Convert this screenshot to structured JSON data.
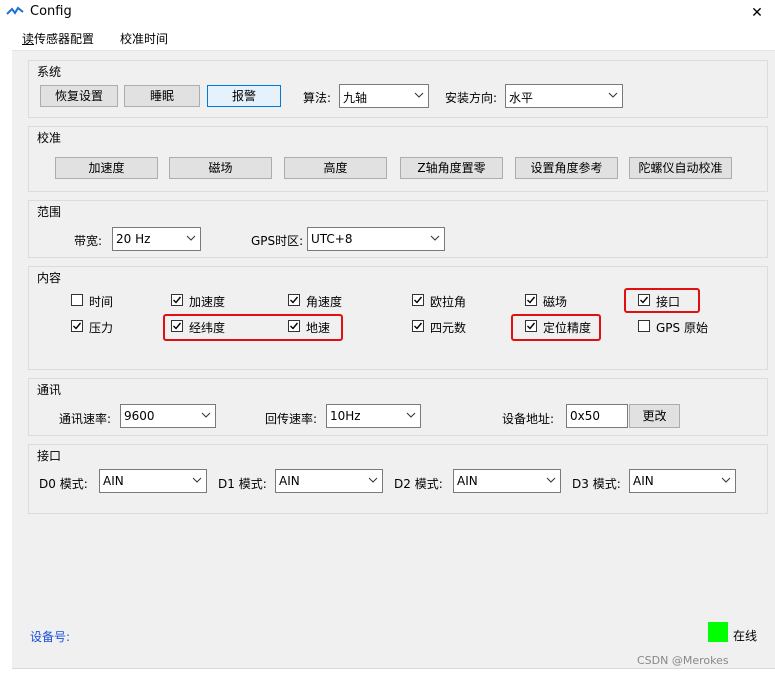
{
  "window": {
    "title": "Config",
    "close_glyph": "✕"
  },
  "menu": [
    {
      "label_underlined": "读",
      "label_rest": "传感器配置"
    },
    {
      "label_underlined": "",
      "label_rest": "校准时间"
    }
  ],
  "system": {
    "title": "系统",
    "buttons": [
      "恢复设置",
      "睡眠",
      "报警"
    ],
    "algorithm_label": "算法:",
    "algorithm_value": "九轴",
    "orientation_label": "安装方向:",
    "orientation_value": "水平"
  },
  "calibration": {
    "title": "校准",
    "buttons": [
      "加速度",
      "磁场",
      "高度",
      "Z轴角度置零",
      "设置角度参考",
      "陀螺仪自动校准"
    ]
  },
  "range": {
    "title": "范围",
    "bandwidth_label": "带宽:",
    "bandwidth_value": "20  Hz",
    "gps_tz_label": "GPS时区:",
    "gps_tz_value": "UTC+8"
  },
  "content": {
    "title": "内容",
    "items": [
      {
        "label": "时间",
        "checked": false
      },
      {
        "label": "加速度",
        "checked": true
      },
      {
        "label": "角速度",
        "checked": true
      },
      {
        "label": "欧拉角",
        "checked": true
      },
      {
        "label": "磁场",
        "checked": true
      },
      {
        "label": "接口",
        "checked": true
      },
      {
        "label": "压力",
        "checked": true
      },
      {
        "label": "经纬度",
        "checked": true
      },
      {
        "label": "地速",
        "checked": true
      },
      {
        "label": "四元数",
        "checked": true
      },
      {
        "label": "定位精度",
        "checked": true
      },
      {
        "label": "GPS 原始",
        "checked": false
      }
    ]
  },
  "comm": {
    "title": "通讯",
    "baud_label": "通讯速率:",
    "baud_value": "9600",
    "rate_label": "回传速率:",
    "rate_value": "10Hz",
    "addr_label": "设备地址:",
    "addr_value": "0x50",
    "change_button": "更改"
  },
  "ports": {
    "title": "接口",
    "items": [
      {
        "label": "D0 模式:",
        "value": "AIN"
      },
      {
        "label": "D1 模式:",
        "value": "AIN"
      },
      {
        "label": "D2 模式:",
        "value": "AIN"
      },
      {
        "label": "D3 模式:",
        "value": "AIN"
      }
    ]
  },
  "footer": {
    "device_label": "设备号:",
    "status_text": "在线",
    "status_color": "#00ff00",
    "watermark": "CSDN @Merokes"
  },
  "highlight_color": "#e01010"
}
